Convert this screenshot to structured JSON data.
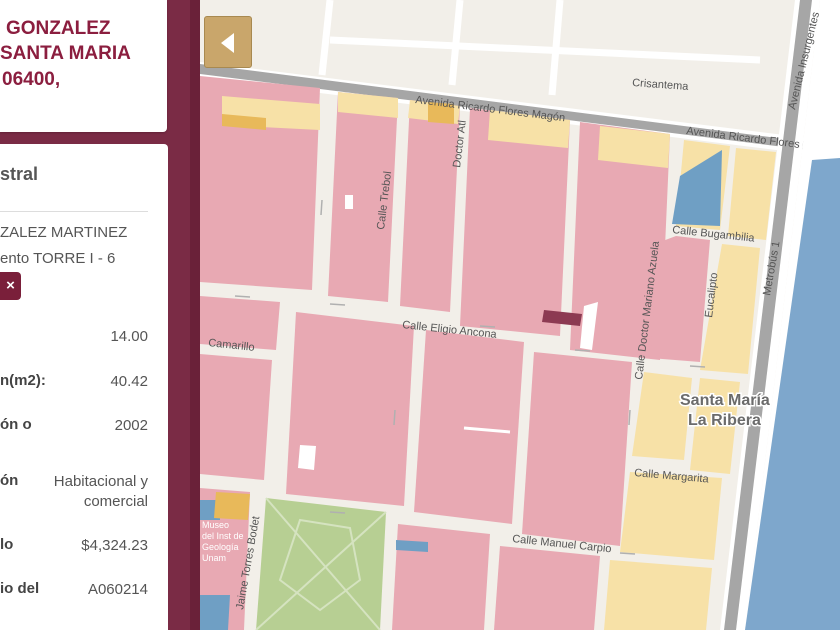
{
  "address": {
    "line1": "GONZALEZ",
    "line2": "SANTA MARIA",
    "line3": "06400,"
  },
  "panel": {
    "title": "stral",
    "owner_line1": "ZALEZ MARTINEZ",
    "owner_line2": "ento TORRE I - 6",
    "close_icon": "×",
    "rows": [
      {
        "label": "",
        "value": "14.00"
      },
      {
        "label": "n(m2):",
        "value": "40.42"
      },
      {
        "label": "ón o",
        "value": "2002"
      },
      {
        "label": "ón",
        "value": "Habitacional y comercial"
      },
      {
        "label": "lo",
        "value": "$4,324.23"
      },
      {
        "label": "io del",
        "value": "A060214"
      }
    ]
  },
  "map": {
    "streets": {
      "crisantema": "Crisantema",
      "ricardo_flores_magon_1": "Avenida Ricardo Flores Magón",
      "ricardo_flores_magon_2": "Avenida Ricardo Flores",
      "insurgentes": "Avenida Insurgentes",
      "doctor_atl": "Doctor Atl",
      "trebol": "Calle Trebol",
      "bugambilia": "Calle Bugambilia",
      "mariano_azuela": "Calle Doctor Mariano Azuela",
      "eucalipto": "Eucalipto",
      "metrobus": "Metrobús 1",
      "eligio_ancona": "Calle Eligio Ancona",
      "camarillo": "Camarillo",
      "margarita": "Calle Margarita",
      "manuel_carpio": "Calle Manuel Carpio",
      "torres_bodet": "Jaime Torres Bodet"
    },
    "neighborhood_line1": "Santa María",
    "neighborhood_line2": "La Ribera",
    "museum_label": [
      "Museo",
      "del Inst de",
      "Geología",
      "Unam"
    ],
    "colors": {
      "residential": "#e8a9b3",
      "commercial": "#f7e1a7",
      "public": "#6f9fc4",
      "park": "#b7cf93",
      "highlight": "#8c3a52",
      "orange": "#e8b95a",
      "street": "#ffffff",
      "avenue": "#9a9a9a",
      "background": "#f2efe9"
    }
  },
  "back_button_icon": "chevron-left-icon"
}
